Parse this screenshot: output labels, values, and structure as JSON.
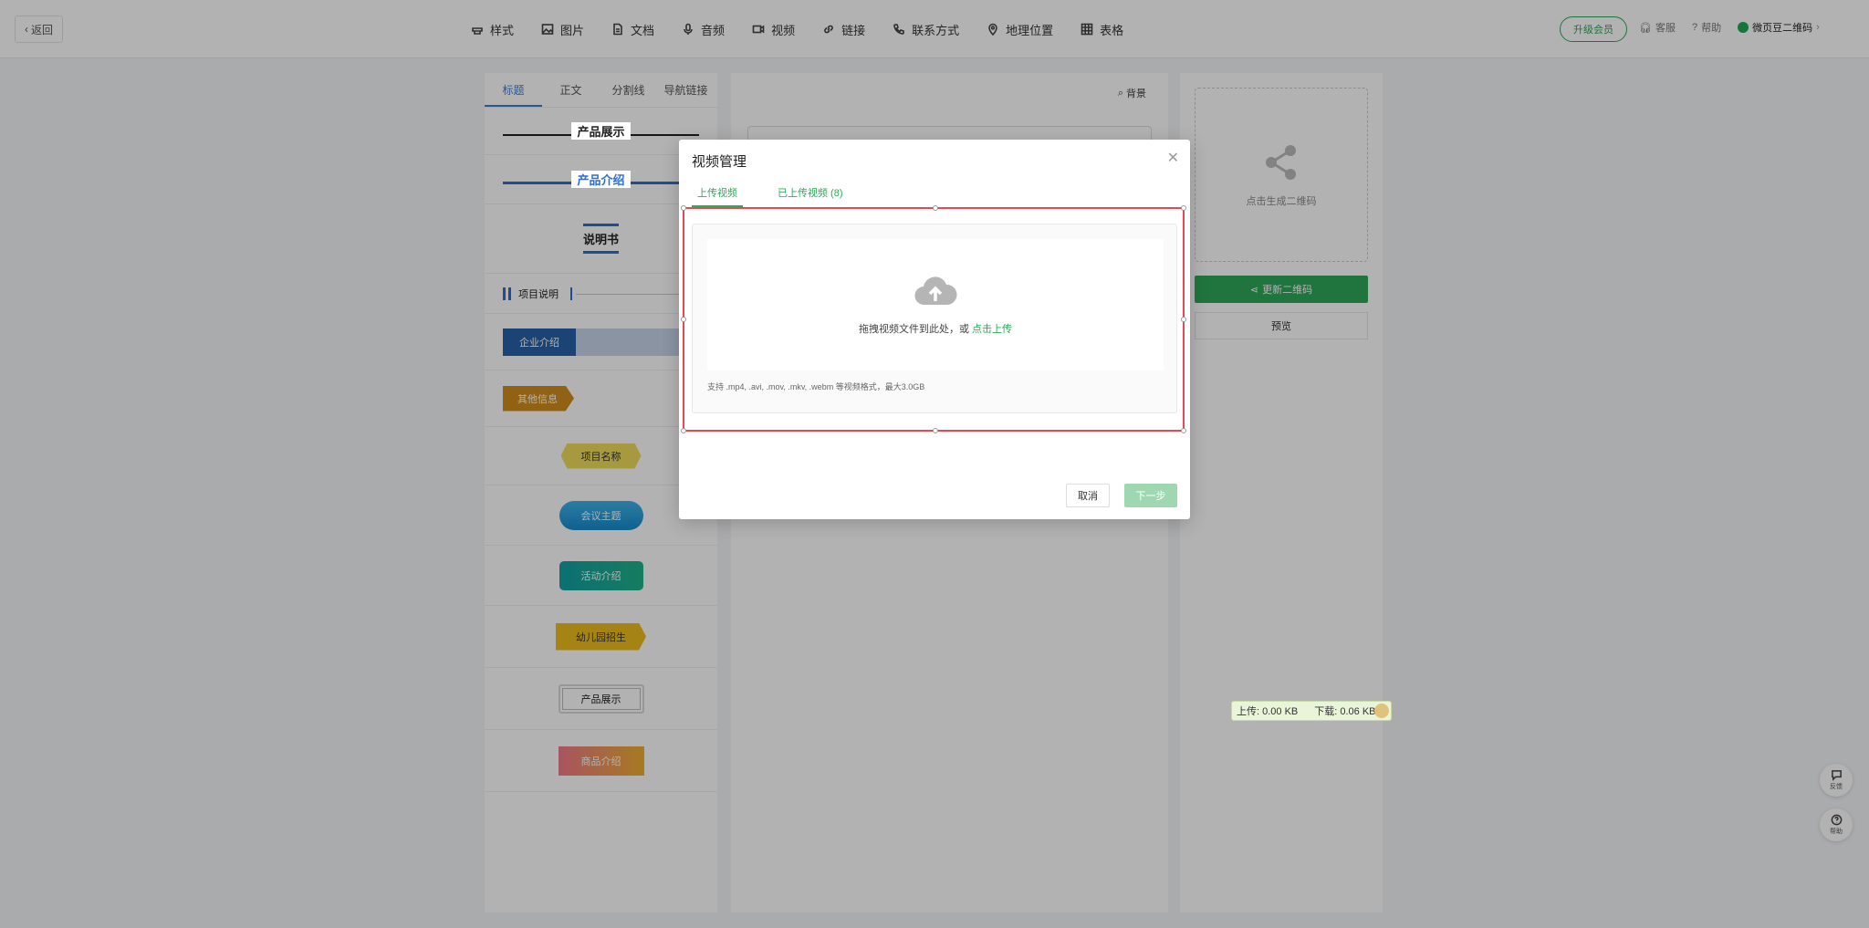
{
  "topbar": {
    "back_label": "返回",
    "nav": [
      {
        "label": "样式",
        "icon": "style-icon"
      },
      {
        "label": "图片",
        "icon": "image-icon"
      },
      {
        "label": "文档",
        "icon": "document-icon"
      },
      {
        "label": "音频",
        "icon": "microphone-icon"
      },
      {
        "label": "视频",
        "icon": "video-icon"
      },
      {
        "label": "链接",
        "icon": "link-icon"
      },
      {
        "label": "联系方式",
        "icon": "phone-icon"
      },
      {
        "label": "地理位置",
        "icon": "location-pin-icon"
      },
      {
        "label": "表格",
        "icon": "table-icon"
      }
    ],
    "upgrade_label": "升级会员",
    "service_label": "客服",
    "help_label": "帮助",
    "brand_label": "微页豆二维码"
  },
  "left_panel": {
    "tabs": [
      "标题",
      "正文",
      "分割线",
      "导航链接"
    ],
    "active_tab": "标题",
    "templates": {
      "t1": "产品展示",
      "t2": "产品介绍",
      "t3": "说明书",
      "t4": "项目说明",
      "t5": "企业介绍",
      "t6": "其他信息",
      "t7": "项目名称",
      "t8": "会议主题",
      "t9": "活动介绍",
      "t10": "幼儿园招生",
      "t11": "产品展示",
      "t12": "商品介绍"
    }
  },
  "center_panel": {
    "background_label": "背景"
  },
  "right_panel": {
    "qr_hint": "点击生成二维码",
    "update_label": "更新二维码",
    "preview_label": "预览"
  },
  "speed_widget": {
    "upload": "上传: 0.00 KB",
    "download": "下载: 0.06 KB"
  },
  "float_buttons": {
    "feedback_label": "反馈",
    "help_label": "帮助"
  },
  "modal": {
    "title": "视频管理",
    "tabs": [
      "上传视频",
      "已上传视频 (8)"
    ],
    "drop_text": "拖拽视频文件到此处，或 ",
    "drop_link": "点击上传",
    "hint": "支持 .mp4, .avi, .mov, .mkv, .webm 等视频格式，最大3.0GB",
    "cancel_label": "取消",
    "next_label": "下一步"
  },
  "colors": {
    "accent_green": "#2ea85a",
    "accent_blue": "#3b80d6",
    "selection_red": "#e24a57"
  }
}
